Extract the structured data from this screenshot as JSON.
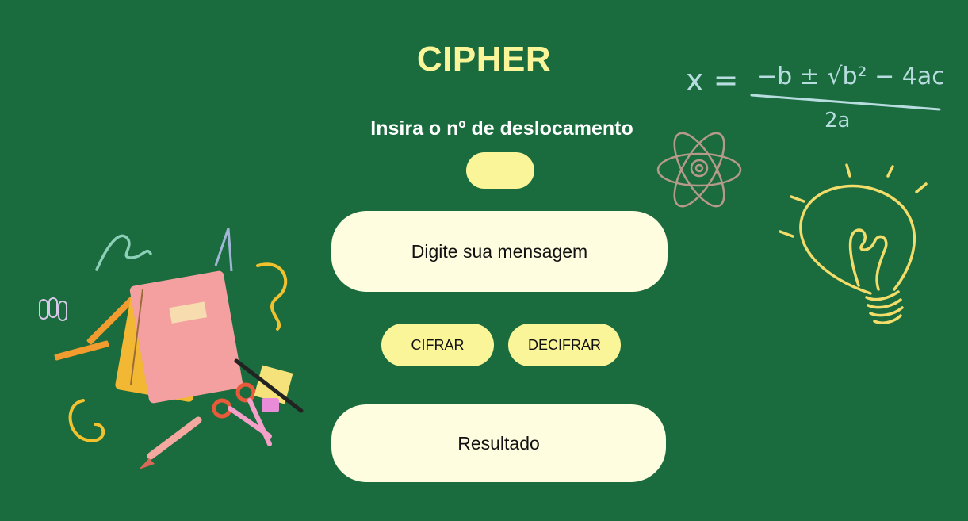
{
  "app": {
    "title": "CIPHER",
    "shift_label": "Insira o nº de deslocamento"
  },
  "shift_input": {
    "value": "",
    "placeholder": ""
  },
  "message_input": {
    "value": "",
    "placeholder": "Digite sua mensagem"
  },
  "actions": {
    "encrypt_label": "CIFRAR",
    "decrypt_label": "DECIFRAR"
  },
  "result": {
    "text": "Resultado"
  },
  "colors": {
    "background": "#1a6b3e",
    "accent_yellow": "#fbf59a",
    "input_cream": "#fefde0",
    "chalk_blue": "#b8dde0",
    "chalk_yellow": "#f2dc6a"
  },
  "decorations": {
    "formula": {
      "left": "x =",
      "numerator": "−b ± √b² − 4ac",
      "denominator": "2a"
    },
    "icons": [
      "atom-icon",
      "lightbulb-icon",
      "school-supplies-illustration"
    ]
  }
}
